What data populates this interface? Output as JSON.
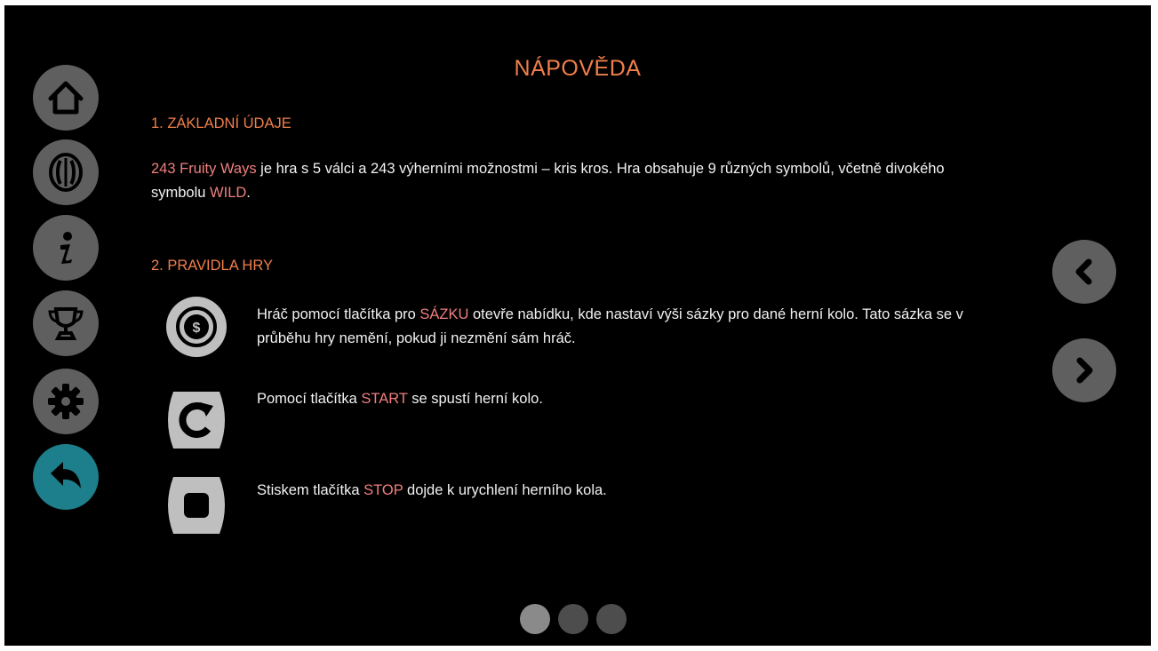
{
  "page": {
    "title": "NÁPOVĚDA"
  },
  "sidebar": {
    "items": [
      {
        "icon": "home-icon"
      },
      {
        "icon": "paytable-icon"
      },
      {
        "icon": "info-icon"
      },
      {
        "icon": "trophy-icon"
      },
      {
        "icon": "gear-icon"
      },
      {
        "icon": "back-icon",
        "active": true
      }
    ]
  },
  "sections": {
    "basic": {
      "heading": "1. ZÁKLADNÍ ÚDAJE",
      "game_name": "243 Fruity Ways",
      "text_1": " je hra s 5 válci a 243 výherními možnostmi – kris kros. Hra obsahuje 9 různých symbolů, včetně divokého symbolu ",
      "wild": "WILD",
      "text_2": "."
    },
    "rules": {
      "heading": "2. PRAVIDLA HRY",
      "items": [
        {
          "icon": "bet-coin-icon",
          "before": "Hráč pomocí tlačítka pro ",
          "highlight": "SÁZKU",
          "after": " otevře nabídku, kde nastaví výši sázky pro dané herní kolo. Tato sázka se v průběhu hry nemění, pokud ji nezmění sám hráč."
        },
        {
          "icon": "start-icon",
          "before": "Pomocí tlačítka ",
          "highlight": "START",
          "after": " se spustí herní kolo."
        },
        {
          "icon": "stop-icon",
          "before": "Stiskem tlačítka ",
          "highlight": "STOP",
          "after": " dojde k urychlení herního kola."
        }
      ]
    }
  },
  "navigation": {
    "prev_icon": "chevron-left-icon",
    "next_icon": "chevron-right-icon",
    "pages": 3,
    "current_page": 1
  },
  "colors": {
    "background": "#000000",
    "heading": "#f07f4a",
    "highlight": "#f07f7f",
    "text": "#f2f2f2",
    "button": "#5f5f5f",
    "active_button": "#1d7f8b",
    "dot_active": "#8a8a8a",
    "dot_inactive": "#4d4d4d"
  }
}
